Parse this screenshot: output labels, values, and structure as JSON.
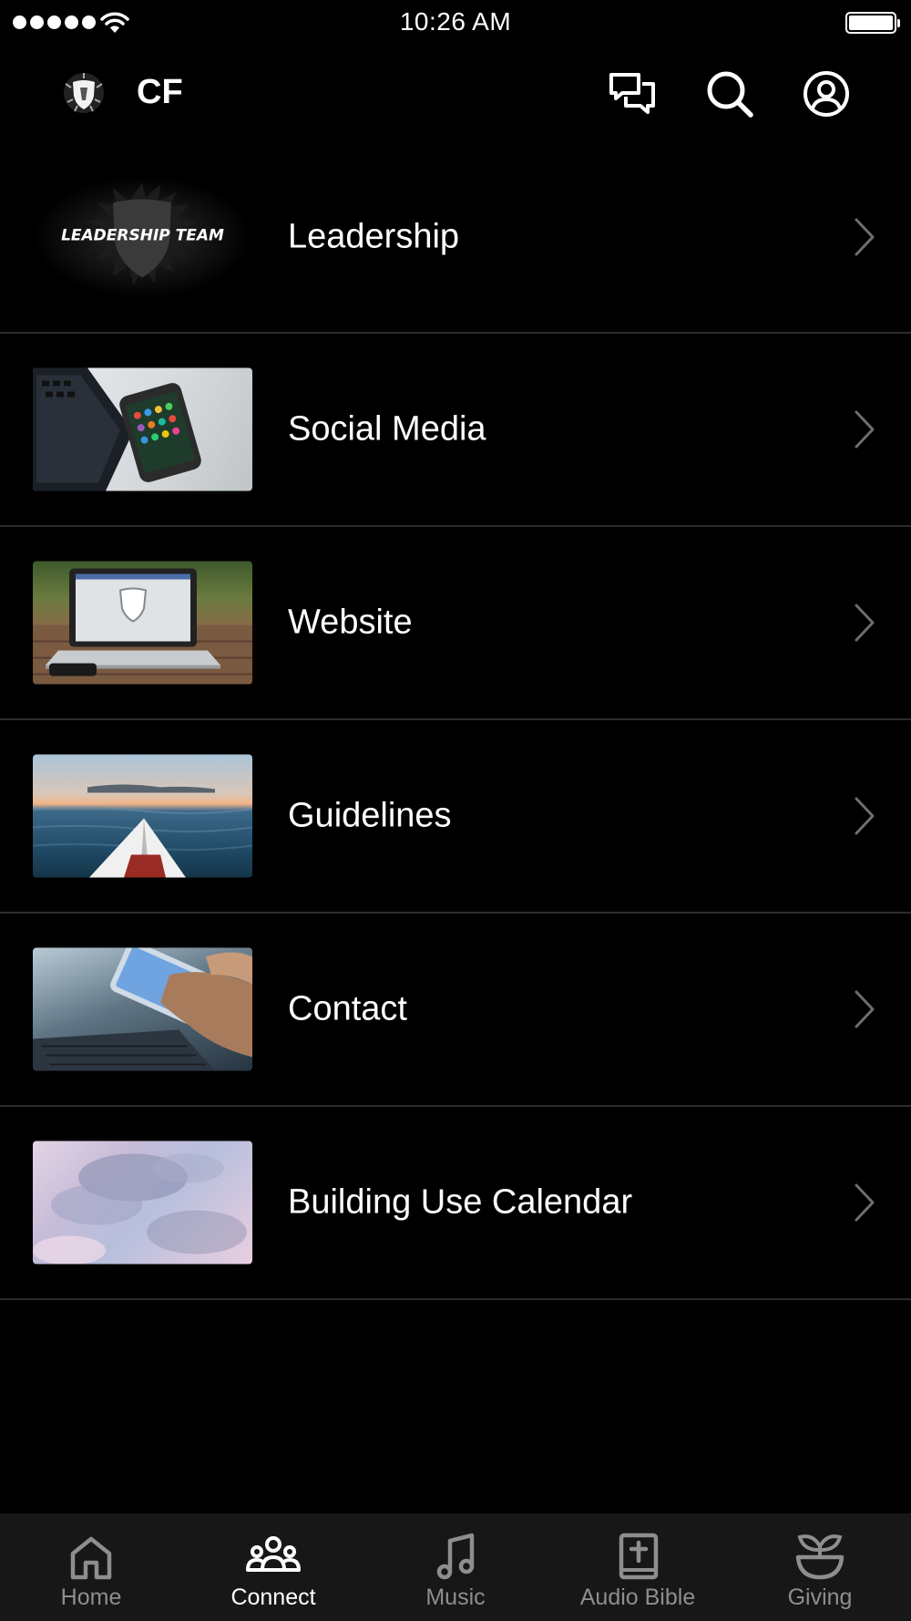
{
  "status_bar": {
    "time": "10:26 AM",
    "signal_dots": 5,
    "battery_level": 1.0
  },
  "header": {
    "title": "CF",
    "logo_icon": "shield-logo-icon",
    "actions": [
      {
        "icon": "chat-icon"
      },
      {
        "icon": "search-icon"
      },
      {
        "icon": "account-icon"
      }
    ]
  },
  "list": {
    "items": [
      {
        "label": "Leadership",
        "thumbnail_text": "LEADERSHIP TEAM",
        "thumbnail": "leadership-team-logo"
      },
      {
        "label": "Social Media",
        "thumbnail": "laptop-and-phone-photo"
      },
      {
        "label": "Website",
        "thumbnail": "laptop-on-table-photo"
      },
      {
        "label": "Guidelines",
        "thumbnail": "kayak-on-lake-photo"
      },
      {
        "label": "Contact",
        "thumbnail": "hand-holding-phone-photo"
      },
      {
        "label": "Building Use Calendar",
        "thumbnail": "clouds-photo"
      }
    ]
  },
  "tabs": [
    {
      "label": "Home",
      "icon": "home-icon",
      "active": false
    },
    {
      "label": "Connect",
      "icon": "people-icon",
      "active": true
    },
    {
      "label": "Music",
      "icon": "music-note-icon",
      "active": false
    },
    {
      "label": "Audio Bible",
      "icon": "bible-icon",
      "active": false
    },
    {
      "label": "Giving",
      "icon": "plant-icon",
      "active": false
    }
  ],
  "colors": {
    "background": "#000000",
    "tab_bar": "#171717",
    "divider": "#2c2c2c",
    "inactive": "#8e8e8e",
    "active": "#ffffff"
  }
}
